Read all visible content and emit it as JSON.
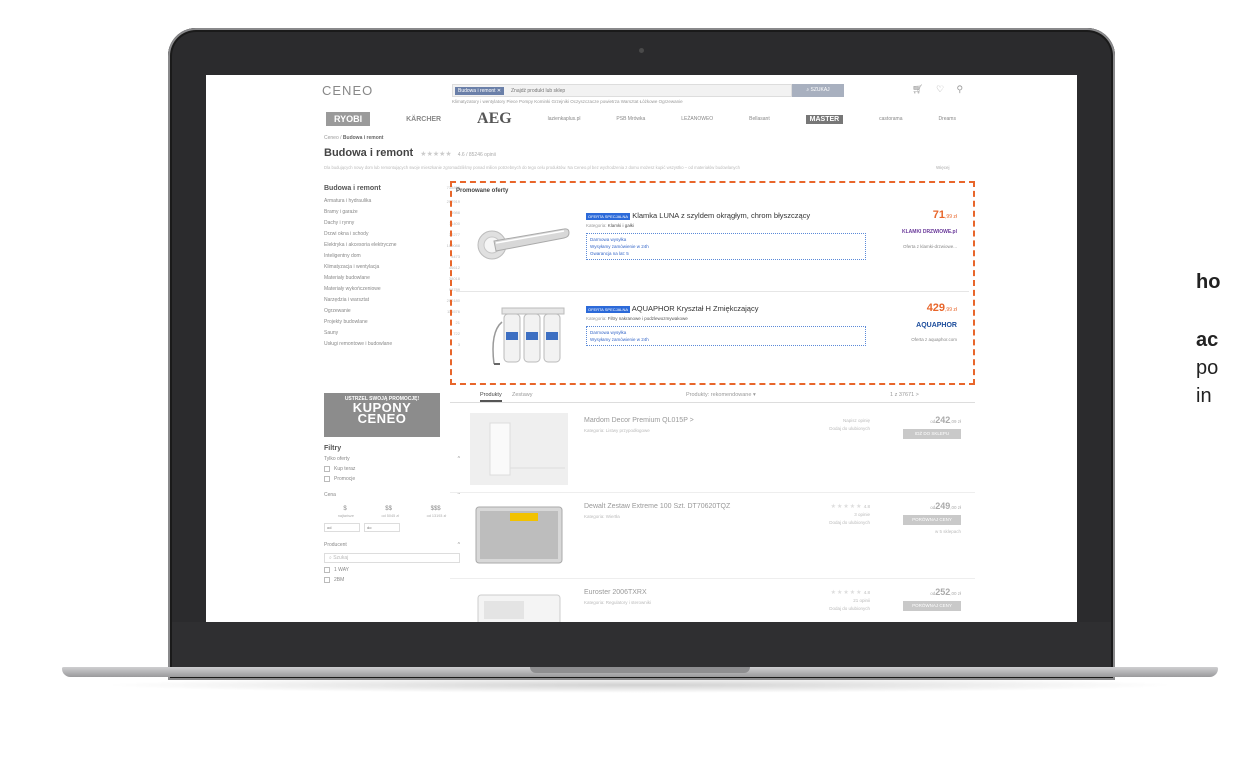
{
  "side_text": {
    "line1": "ho",
    "line2": "ac",
    "line3": "po",
    "line4": "in"
  },
  "site": {
    "logo": "CENEO",
    "search": {
      "chip": "Budowa i remont ✕",
      "placeholder": "Znajdź produkt lub sklep",
      "button": "SZUKAJ"
    },
    "icons": [
      "cart-icon",
      "heart-icon",
      "user-icon"
    ],
    "subnav": "Klimatyzatory i wentylatory   Piece   Pompy   Kominki   Grzejniki   Oczyszczacze powietrza   Warsztat   Łóżkowe   Ogrzewanie",
    "brands": [
      "RYOBI",
      "KÄRCHER",
      "AEG",
      "lazienkaplus.pl",
      "PSB Mrówka",
      "LEŻANOWEO",
      "Bellasant",
      "MASTER",
      "castorama",
      "Dreams"
    ],
    "breadcrumb": {
      "root": "Ceneo",
      "sep": "/",
      "current": "Budowa i remont"
    },
    "title": "Budowa i remont",
    "title_stars": "★★★★★",
    "title_rating": "4.6 / 85246 opinii",
    "description": "Dla budujących nowy dom lub remontujących swoje mieszkanie zgromadziliśmy ponad milion potrzebnych do tego celu produktów. Na Ceneo.pl bez wychodzenia z domu możesz kupić wszystko – od materiałów budowlanych",
    "more_link": "Więcej",
    "categories_head": {
      "label": "Budowa i remont",
      "count": "738896"
    },
    "categories": [
      {
        "label": "Armatura i hydraulika",
        "count": "207919"
      },
      {
        "label": "Bramy i garaże",
        "count": "5988"
      },
      {
        "label": "Dachy i rynny",
        "count": "11400"
      },
      {
        "label": "Drzwi okna i schody",
        "count": "32277"
      },
      {
        "label": "Elektryka i akcesoria elektryczne",
        "count": "109088"
      },
      {
        "label": "Inteligentny dom",
        "count": "3473"
      },
      {
        "label": "Klimatyzacja i wentylacja",
        "count": "46612"
      },
      {
        "label": "Materiały budowlane",
        "count": "38018"
      },
      {
        "label": "Materiały wykończeniowe",
        "count": "98789"
      },
      {
        "label": "Narzędzia i warsztat",
        "count": "200180"
      },
      {
        "label": "Ogrzewanie",
        "count": "115576"
      },
      {
        "label": "Projekty budowlane",
        "count": "21"
      },
      {
        "label": "Sauny",
        "count": "722"
      },
      {
        "label": "Usługi remontowe i budowlane",
        "count": "3"
      }
    ],
    "promo_banner": {
      "line1": "USTRZEL SWOJĄ PROMOCJĘ!",
      "line2": "KUPONY",
      "line3": "CENEO"
    },
    "filters": {
      "title": "Filtry",
      "only_offers": "Tylko oferty",
      "buy_now": "Kup teraz",
      "promotions": "Promocje",
      "price": "Cena",
      "price_levels": [
        "$",
        "$$",
        "$$$"
      ],
      "price_ranges": [
        "najtańsze",
        "od 5045 zł",
        "od 13193 zł"
      ],
      "min": "od",
      "max": "do",
      "producer": "Producent",
      "producer_search": "Szukaj",
      "producers": [
        {
          "label": "1 WAY",
          "count": "1"
        },
        {
          "label": "2BM",
          "count": "340"
        }
      ]
    },
    "promoted": {
      "header": "Promowane oferty",
      "offers": [
        {
          "badge": "OFERTA SPECJALNA",
          "name": "Klamka LUNA z szyldem okrągłym, chrom błyszczący",
          "category_label": "Kategoria:",
          "category": "Klamki i gałki",
          "perks": [
            "Darmowa wysyłka",
            "Wysyłamy zamówienie w 24h",
            "Gwarancja na lat: 5"
          ],
          "price_int": "71",
          "price_dec": ",99 zł",
          "shop": "KLAMKI DRZWIOWE.pl",
          "via": "Oferta z klamki-drzwiowe..."
        },
        {
          "badge": "OFERTA SPECJALNA",
          "name": "AQUAPHOR Kryształ H Zmiękczający",
          "category_label": "Kategoria:",
          "category": "Filtry nakranowe i podzlewozmywakowe",
          "perks": [
            "Darmowa wysyłka",
            "Wysyłamy zamówienie w 24h"
          ],
          "price_int": "429",
          "price_dec": ",99 zł",
          "shop": "AQUAPHOR",
          "via": "Oferta z aquaphor.com"
        }
      ]
    },
    "tabs": {
      "products": "Produkty",
      "sets": "Zestawy",
      "sort": "Produkty: rekomendowane ▾",
      "pagination": "1  z 37671  >"
    },
    "products": [
      {
        "name": "Mardom Decor Premium QL015P >",
        "category": "Kategoria: Listwy przypodłogowe",
        "reviews": "Napisz opinię",
        "fav": "Dodaj do ulubionych",
        "price_prefix": "od",
        "price": "242",
        "price_dec": ",09 zł",
        "button": "IDŹ DO SKLEPU",
        "note": ""
      },
      {
        "name": "Dewalt Zestaw Extreme 100 Szt. DT70620TQZ",
        "category": "Kategoria: Wiertła",
        "rating": "4.8",
        "reviews": "3 opinie",
        "fav": "Dodaj do ulubionych",
        "price_prefix": "od",
        "price": "249",
        "price_dec": ",00 zł",
        "button": "PORÓWNAJ CENY",
        "note": "w 5 sklepach"
      },
      {
        "name": "Euroster 2006TXRX",
        "category": "Kategoria: Regulatory i sterowniki",
        "rating": "4.8",
        "reviews": "21 opinii",
        "fav": "Dodaj do ulubionych",
        "price_prefix": "od",
        "price": "252",
        "price_dec": ",00 zł",
        "button": "PORÓWNAJ CENY",
        "note": ""
      }
    ]
  }
}
